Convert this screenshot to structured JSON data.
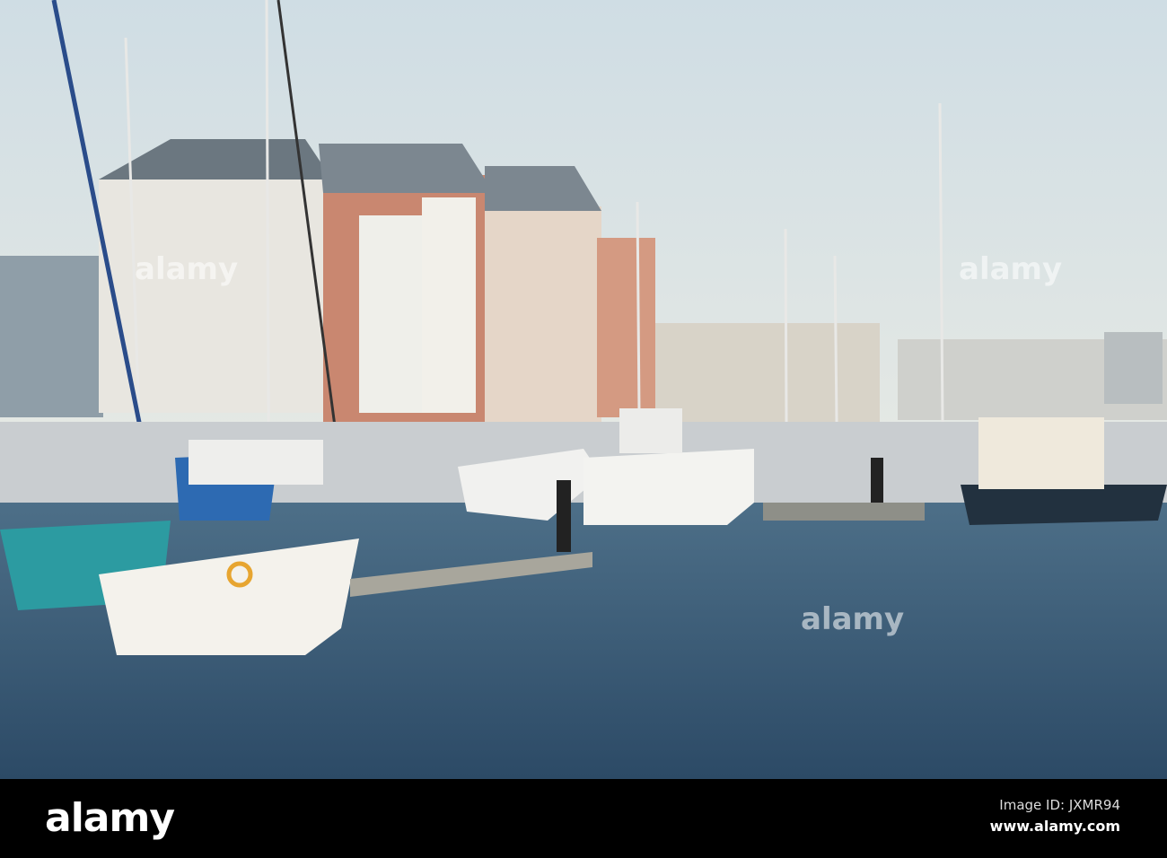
{
  "photo": {
    "subject": "marina"
  },
  "watermark": {
    "text": "alamy"
  },
  "footer": {
    "logo": "alamy",
    "image_id": "Image ID: JXMR94",
    "website": "www.alamy.com"
  }
}
